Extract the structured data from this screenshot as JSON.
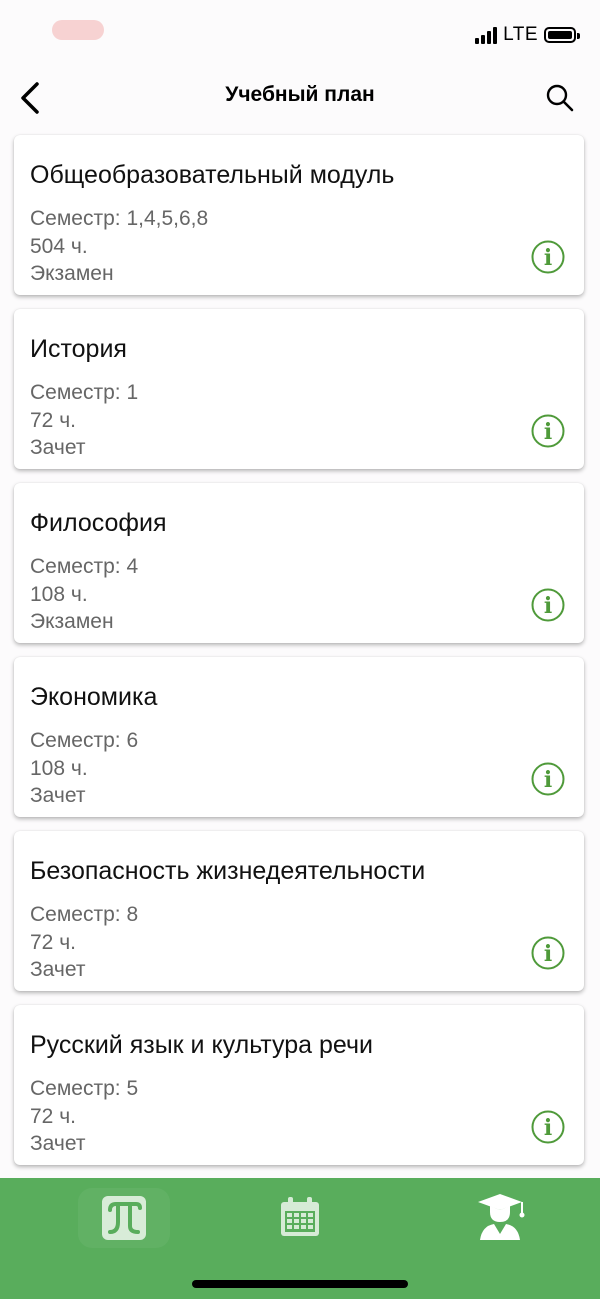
{
  "status_bar": {
    "network": "LTE"
  },
  "nav": {
    "title": "Учебный план"
  },
  "semester_label": "Семестр:",
  "courses": [
    {
      "name": "Общеобразовательный модуль",
      "semesters": "1,4,5,6,8",
      "hours": "504 ч.",
      "control": "Экзамен"
    },
    {
      "name": "История",
      "semesters": "1",
      "hours": "72 ч.",
      "control": "Зачет"
    },
    {
      "name": "Философия",
      "semesters": "4",
      "hours": "108 ч.",
      "control": "Экзамен"
    },
    {
      "name": "Экономика",
      "semesters": "6",
      "hours": "108 ч.",
      "control": "Зачет"
    },
    {
      "name": "Безопасность жизнедеятельности",
      "semesters": "8",
      "hours": "72 ч.",
      "control": "Зачет"
    },
    {
      "name": "Русский язык и культура речи",
      "semesters": "5",
      "hours": "72 ч.",
      "control": "Зачет"
    }
  ],
  "tabs": {
    "home": {
      "icon": "university-logo-icon",
      "active": false
    },
    "schedule": {
      "icon": "calendar-icon",
      "active": false
    },
    "plan": {
      "icon": "graduate-icon",
      "active": true
    }
  },
  "colors": {
    "accent": "#59ad5c",
    "info_icon": "#4f9a3a",
    "secondary_text": "#666666"
  }
}
